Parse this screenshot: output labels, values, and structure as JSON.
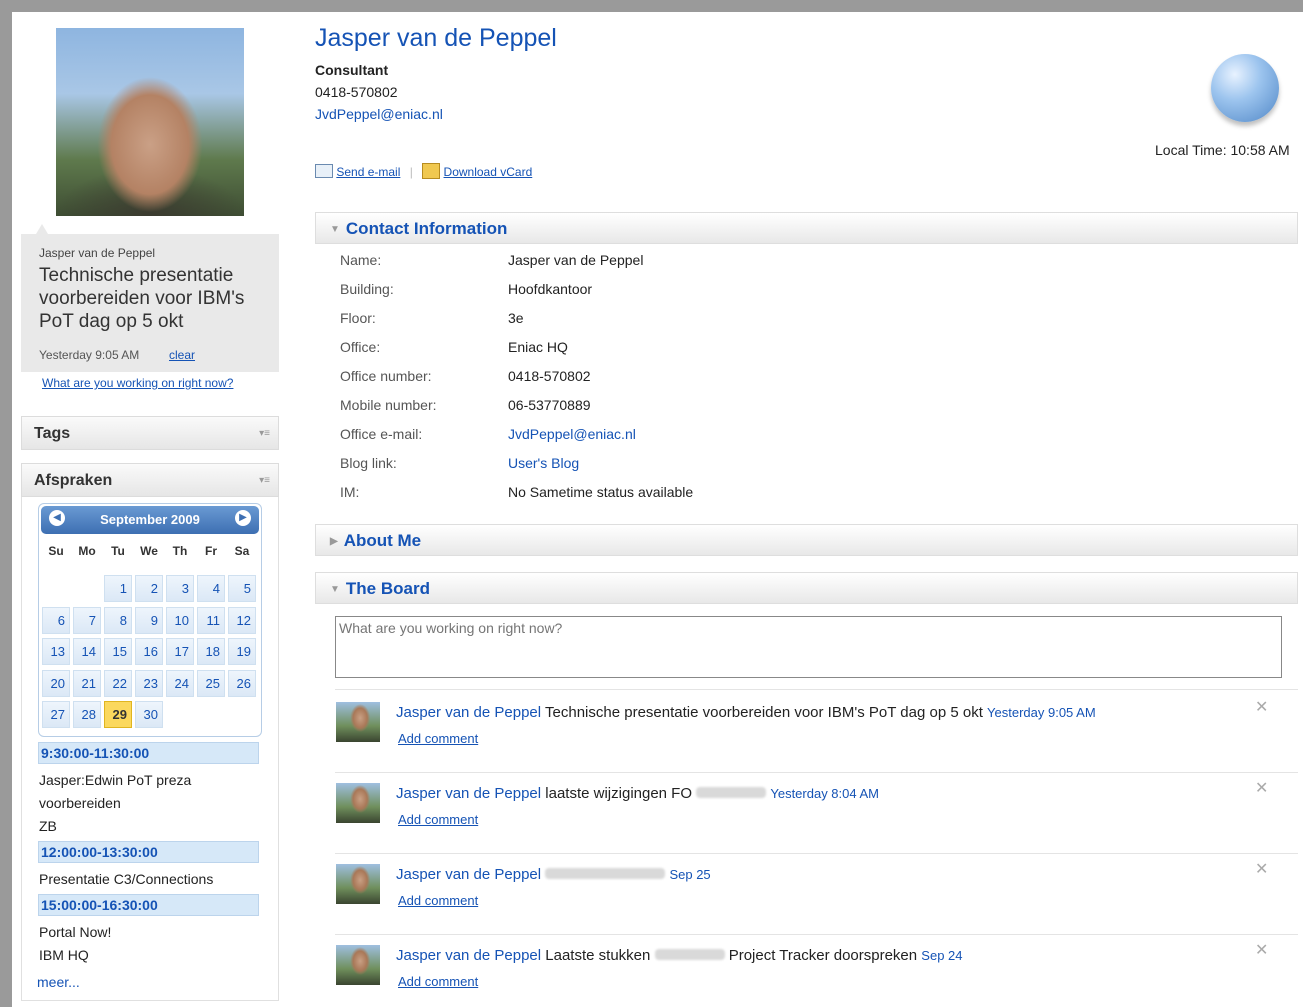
{
  "profile": {
    "name": "Jasper van de Peppel",
    "title": "Consultant",
    "phone": "0418-570802",
    "email": "JvdPeppel@eniac.nl",
    "actions": {
      "send_email": "Send e-mail",
      "download_vcard": "Download vCard"
    },
    "local_time": "Local Time: 10:58 AM"
  },
  "status": {
    "author": "Jasper van de Peppel",
    "message": "Technische presentatie voorbereiden voor IBM's PoT dag op 5 okt",
    "time": "Yesterday 9:05 AM",
    "clear_label": "clear",
    "prompt_link": "What are you working on right now?"
  },
  "tags": {
    "title": "Tags"
  },
  "afspraken": {
    "title": "Afspraken",
    "calendar": {
      "month": "September 2009",
      "weekdays": [
        "Su",
        "Mo",
        "Tu",
        "We",
        "Th",
        "Fr",
        "Sa"
      ],
      "weeks": [
        [
          "",
          "",
          "1",
          "2",
          "3",
          "4",
          "5"
        ],
        [
          "6",
          "7",
          "8",
          "9",
          "10",
          "11",
          "12"
        ],
        [
          "13",
          "14",
          "15",
          "16",
          "17",
          "18",
          "19"
        ],
        [
          "20",
          "21",
          "22",
          "23",
          "24",
          "25",
          "26"
        ],
        [
          "27",
          "28",
          "29",
          "30",
          "",
          "",
          ""
        ]
      ],
      "today": "29"
    },
    "appointments": [
      {
        "time": "9:30:00-11:30:00",
        "lines": [
          "Jasper:Edwin PoT preza",
          "voorbereiden",
          "ZB"
        ]
      },
      {
        "time": "12:00:00-13:30:00",
        "lines": [
          "Presentatie C3/Connections"
        ]
      },
      {
        "time": "15:00:00-16:30:00",
        "lines": [
          "Portal Now!",
          "IBM HQ"
        ]
      }
    ],
    "more_label": "meer..."
  },
  "contact": {
    "title": "Contact Information",
    "rows": [
      {
        "label": "Name:",
        "value": "Jasper van de Peppel"
      },
      {
        "label": "Building:",
        "value": "Hoofdkantoor"
      },
      {
        "label": "Floor:",
        "value": "3e"
      },
      {
        "label": "Office:",
        "value": "Eniac HQ"
      },
      {
        "label": "Office number:",
        "value": "0418-570802"
      },
      {
        "label": "Mobile number:",
        "value": "06-53770889"
      },
      {
        "label": "Office e-mail:",
        "value": "JvdPeppel@eniac.nl"
      },
      {
        "label": "Blog link:",
        "value": "User's Blog"
      },
      {
        "label": "IM:",
        "value": "No Sametime status available"
      }
    ]
  },
  "about": {
    "title": "About Me"
  },
  "board": {
    "title": "The Board",
    "input_placeholder": "What are you working on right now?",
    "posts": [
      {
        "author": "Jasper van de Peppel",
        "text_before": "Technische presentatie voorbereiden voor IBM's PoT dag op 5 okt",
        "text_after": "",
        "date": "Yesterday 9:05 AM",
        "comment": "Add comment"
      },
      {
        "author": "Jasper van de Peppel",
        "text_before": "laatste wijzigingen FO",
        "text_after": "",
        "date": "Yesterday 8:04 AM",
        "comment": "Add comment"
      },
      {
        "author": "Jasper van de Peppel",
        "text_before": "",
        "text_after": "",
        "date": "Sep 25",
        "comment": "Add comment"
      },
      {
        "author": "Jasper van de Peppel",
        "text_before": "Laatste stukken",
        "text_after": "Project Tracker doorspreken",
        "date": "Sep 24",
        "comment": "Add comment"
      }
    ]
  },
  "colors": {
    "link": "#1553b5",
    "header_blue": "#3d6fb2",
    "today": "#fbd85d"
  }
}
